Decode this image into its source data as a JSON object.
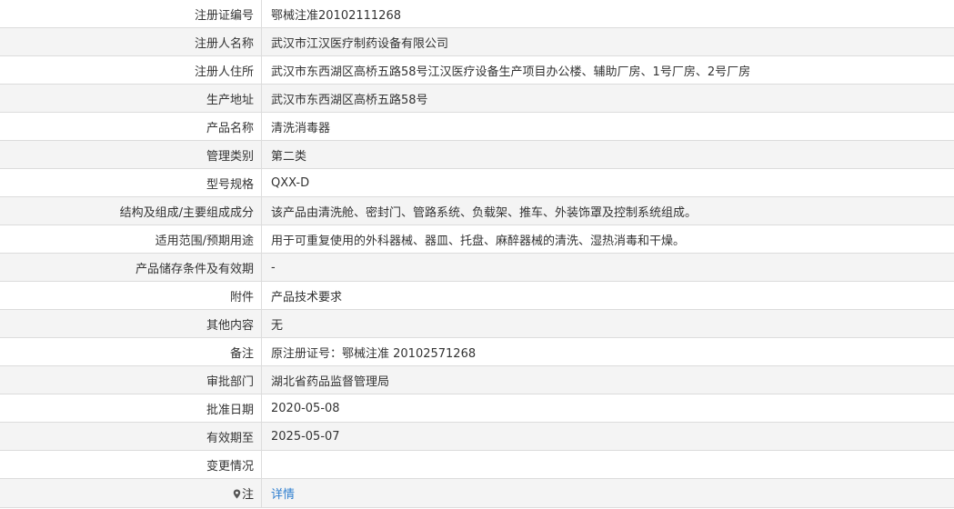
{
  "rows": [
    {
      "label": "注册证编号",
      "value": "鄂械注准20102111268"
    },
    {
      "label": "注册人名称",
      "value": "武汉市江汉医疗制药设备有限公司"
    },
    {
      "label": "注册人住所",
      "value": "武汉市东西湖区高桥五路58号江汉医疗设备生产项目办公楼、辅助厂房、1号厂房、2号厂房"
    },
    {
      "label": "生产地址",
      "value": "武汉市东西湖区高桥五路58号"
    },
    {
      "label": "产品名称",
      "value": "清洗消毒器"
    },
    {
      "label": "管理类别",
      "value": "第二类"
    },
    {
      "label": "型号规格",
      "value": "QXX-D"
    },
    {
      "label": "结构及组成/主要组成成分",
      "value": "该产品由清洗舱、密封门、管路系统、负载架、推车、外装饰罩及控制系统组成。"
    },
    {
      "label": "适用范围/预期用途",
      "value": "用于可重复使用的外科器械、器皿、托盘、麻醉器械的清洗、湿热消毒和干燥。"
    },
    {
      "label": "产品储存条件及有效期",
      "value": "-"
    },
    {
      "label": "附件",
      "value": "产品技术要求"
    },
    {
      "label": "其他内容",
      "value": "无"
    },
    {
      "label": "备注",
      "value": "原注册证号：鄂械注准 20102571268"
    },
    {
      "label": "审批部门",
      "value": "湖北省药品监督管理局"
    },
    {
      "label": "批准日期",
      "value": "2020-05-08"
    },
    {
      "label": "有效期至",
      "value": "2025-05-07"
    },
    {
      "label": "变更情况",
      "value": ""
    }
  ],
  "note": {
    "icon": "info-pin-icon",
    "label": "注",
    "link_text": "详情"
  }
}
